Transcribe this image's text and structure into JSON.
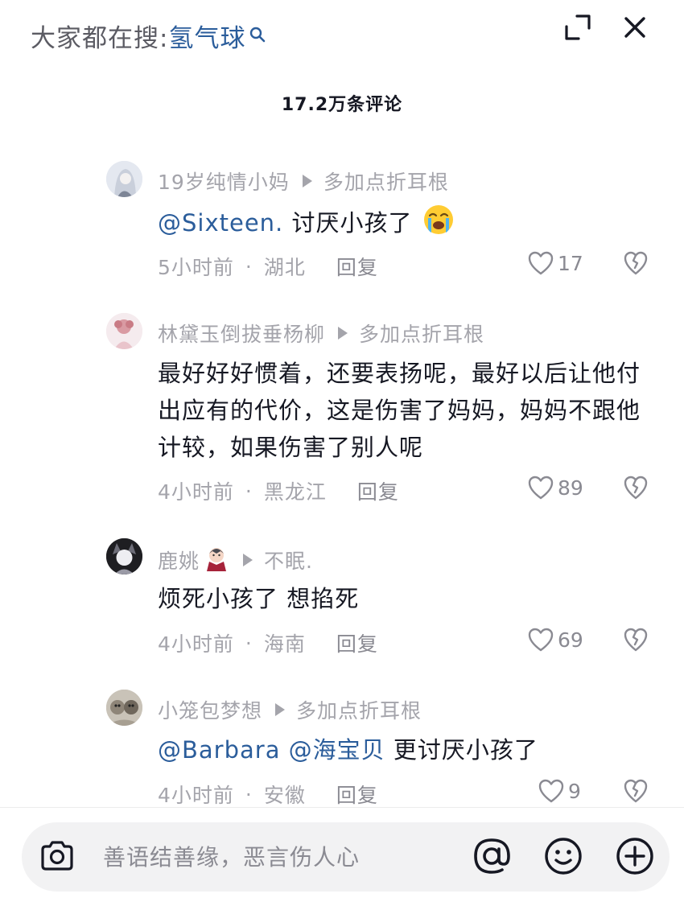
{
  "header": {
    "hot_search_prefix": "大家都在搜:",
    "hot_search_term": "氢气球",
    "hot_search_icon": "search-icon",
    "expand_icon": "expand-icon",
    "close_icon": "close-icon",
    "comment_count": "17.2万条评论"
  },
  "comments": [
    {
      "username": "19岁纯情小妈",
      "reply_to": "多加点折耳根",
      "mention": "@Sixteen.",
      "text": " 讨厌小孩了",
      "emoji": "crying-face-emoji",
      "time": "5小时前",
      "location": "湖北",
      "reply_label": "回复",
      "likes": "17",
      "avatar_color": "#dfe4ee"
    },
    {
      "username": "林黛玉倒拔垂杨柳",
      "reply_to": "多加点折耳根",
      "text": "最好好好惯着，还要表扬呢，最好以后让他付出应有的代价，这是伤害了妈妈，妈妈不跟他计较，如果伤害了别人呢",
      "time": "4小时前",
      "location": "黑龙江",
      "reply_label": "回复",
      "likes": "89",
      "avatar_color": "#f1e3e6"
    },
    {
      "username": "鹿姚",
      "username_emoji": "vampire-emoji",
      "reply_to": "不眠.",
      "text": "烦死小孩了 想掐死",
      "time": "4小时前",
      "location": "海南",
      "reply_label": "回复",
      "likes": "69",
      "avatar_color": "#2a2a2e"
    },
    {
      "username": "小笼包梦想",
      "reply_to": "多加点折耳根",
      "mention": "@Barbara @海宝贝",
      "text": " 更讨厌小孩了",
      "time": "4小时前",
      "location": "安徽",
      "reply_label": "回复",
      "likes": "9",
      "avatar_color": "#b9b2a6"
    }
  ],
  "meta_separator": "·",
  "input": {
    "placeholder": "善语结善缘，恶言伤人心",
    "camera_icon": "camera-icon",
    "at_icon": "at-icon",
    "emoji_icon": "emoji-icon",
    "plus_icon": "plus-icon"
  },
  "colors": {
    "link": "#2b5d9b",
    "muted": "#a4a4ab",
    "text": "#161823",
    "input_bg": "#f2f2f3"
  }
}
